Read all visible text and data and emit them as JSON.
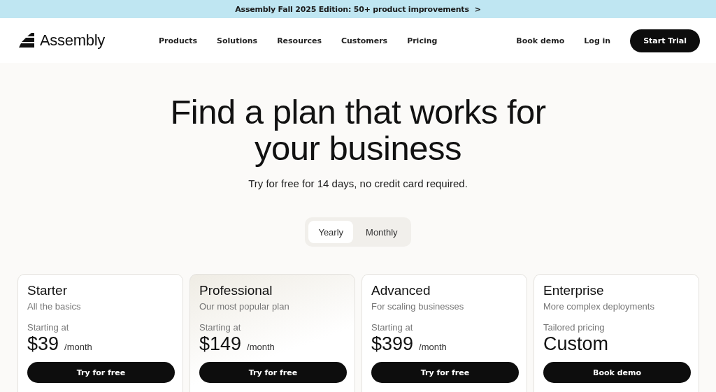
{
  "banner": {
    "text": "Assembly Fall 2025 Edition: 50+ product improvements",
    "arrow": ">"
  },
  "header": {
    "logo_text": "Assembly",
    "nav": [
      "Products",
      "Solutions",
      "Resources",
      "Customers",
      "Pricing"
    ],
    "actions": [
      {
        "label": "Book demo",
        "kind": "link"
      },
      {
        "label": "Log in",
        "kind": "link"
      },
      {
        "label": "Start Trial",
        "kind": "primary"
      }
    ]
  },
  "hero": {
    "title_lines": [
      "Find a plan that works for",
      "your business"
    ],
    "subtitle": "Try for free for 14 days, no credit card required."
  },
  "billing_toggle": [
    {
      "label": "Yearly",
      "selected": true
    },
    {
      "label": "Monthly",
      "selected": false
    }
  ],
  "plans": [
    {
      "name": "Starter",
      "tagline": "All the basics",
      "price_label": "Starting at",
      "price": "$39",
      "period": "/month",
      "button": "Try for free",
      "featured": false
    },
    {
      "name": "Professional",
      "tagline": "Our most popular plan",
      "price_label": "Starting at",
      "price": "$149",
      "period": "/month",
      "button": "Try for free",
      "featured": true
    },
    {
      "name": "Advanced",
      "tagline": "For scaling businesses",
      "price_label": "Starting at",
      "price": "$399",
      "period": "/month",
      "button": "Try for free",
      "featured": false
    },
    {
      "name": "Enterprise",
      "tagline": "More complex deployments",
      "price_label": "Tailored pricing",
      "price": "Custom",
      "button": "Book demo",
      "featured": false
    }
  ]
}
